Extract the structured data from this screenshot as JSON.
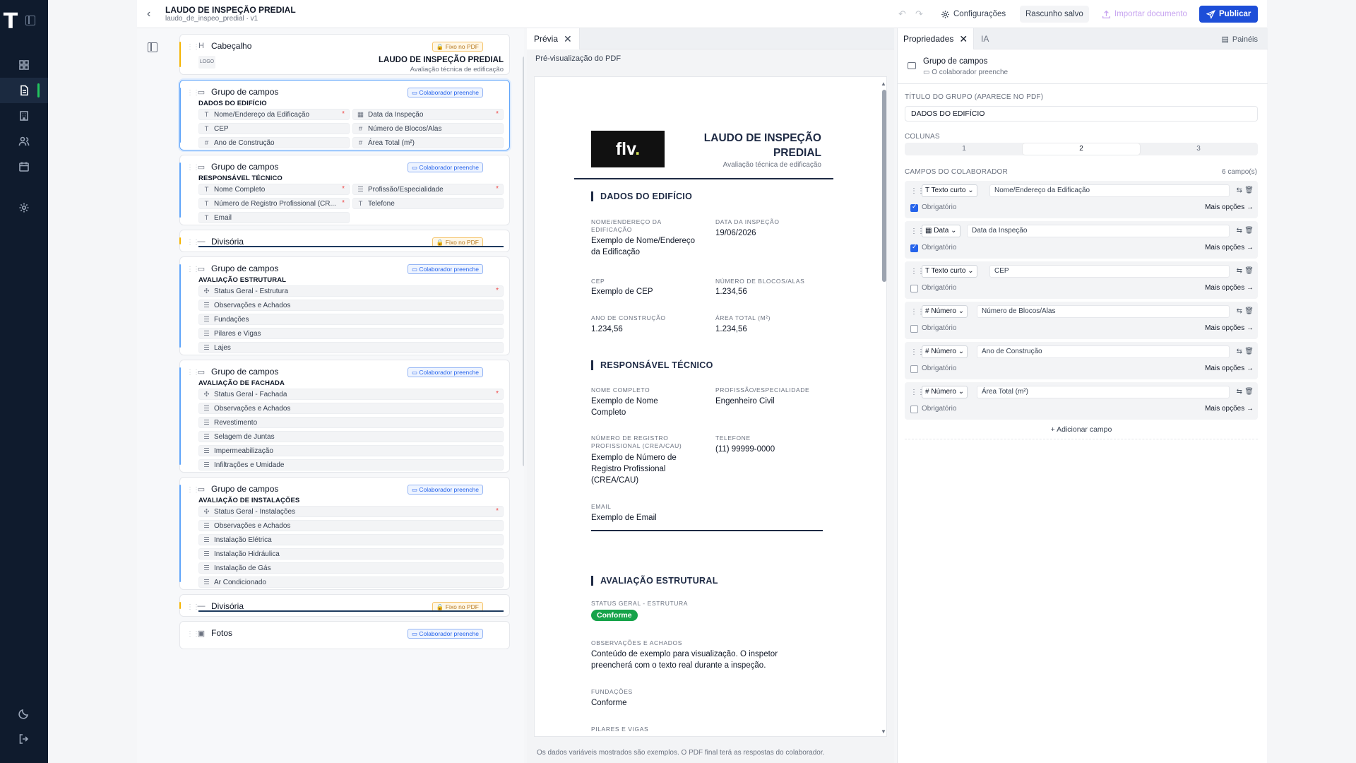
{
  "header": {
    "title": "LAUDO DE INSPEÇÃO PREDIAL",
    "subtitle": "laudo_de_inspeo_predial · v1",
    "undo_icon": "undo-icon",
    "redo_icon": "redo-icon",
    "config_label": "Configurações",
    "draft_label": "Rascunho salvo",
    "import_label": "Importar documento",
    "publish_label": "Publicar"
  },
  "outline": {
    "blocks": [
      {
        "type": "Cabeçalho",
        "badge": "Fixo no PDF",
        "logo": "LOGO",
        "title": "LAUDO DE INSPEÇÃO PREDIAL",
        "sub": "Avaliação técnica de edificação"
      },
      {
        "type": "Grupo de campos",
        "badge": "Colaborador preenche",
        "title": "DADOS DO EDIFÍCIO",
        "fields": [
          "Nome/Endereço da Edificação",
          "Data da Inspeção",
          "CEP",
          "Número de Blocos/Alas",
          "Ano de Construção",
          "Área Total (m²)"
        ]
      },
      {
        "type": "Grupo de campos",
        "badge": "Colaborador preenche",
        "title": "RESPONSÁVEL TÉCNICO",
        "fields": [
          "Nome Completo",
          "Profissão/Especialidade",
          "Número de Registro Profissional (CR...",
          "Telefone",
          "Email"
        ]
      },
      {
        "type": "Divisória",
        "badge": "Fixo no PDF"
      },
      {
        "type": "Grupo de campos",
        "badge": "Colaborador preenche",
        "title": "AVALIAÇÃO ESTRUTURAL",
        "fields": [
          "Status Geral - Estrutura",
          "Observações e Achados",
          "Fundações",
          "Pilares e Vigas",
          "Lajes"
        ]
      },
      {
        "type": "Grupo de campos",
        "badge": "Colaborador preenche",
        "title": "AVALIAÇÃO DE FACHADA",
        "fields": [
          "Status Geral - Fachada",
          "Observações e Achados",
          "Revestimento",
          "Selagem de Juntas",
          "Impermeabilização",
          "Infiltrações e Umidade"
        ]
      },
      {
        "type": "Grupo de campos",
        "badge": "Colaborador preenche",
        "title": "AVALIAÇÃO DE INSTALAÇÕES",
        "fields": [
          "Status Geral - Instalações",
          "Observações e Achados",
          "Instalação Elétrica",
          "Instalação Hidráulica",
          "Instalação de Gás",
          "Ar Condicionado"
        ]
      },
      {
        "type": "Divisória",
        "badge": "Fixo no PDF"
      },
      {
        "type": "Fotos",
        "badge": "Colaborador preenche"
      }
    ]
  },
  "preview": {
    "tab_label": "Prévia",
    "heading": "Pré-visualização do PDF",
    "footer": "Os dados variáveis mostrados são exemplos. O PDF final terá as respostas do colaborador.",
    "pdf": {
      "logo_text": "flv",
      "logo_dot": ".",
      "title": "LAUDO DE INSPEÇÃO PREDIAL",
      "subtitle": "Avaliação técnica de edificação",
      "sec1": "DADOS DO EDIFÍCIO",
      "f_nome_lbl": "NOME/ENDEREÇO DA EDIFICAÇÃO",
      "f_nome_val": "Exemplo de Nome/Endereço da Edificação",
      "f_data_lbl": "DATA DA INSPEÇÃO",
      "f_data_val": "19/06/2026",
      "f_cep_lbl": "CEP",
      "f_cep_val": "Exemplo de CEP",
      "f_blocos_lbl": "NÚMERO DE BLOCOS/ALAS",
      "f_blocos_val": "1.234,56",
      "f_ano_lbl": "ANO DE CONSTRUÇÃO",
      "f_ano_val": "1.234,56",
      "f_area_lbl": "ÁREA TOTAL (M²)",
      "f_area_val": "1.234,56",
      "sec2": "RESPONSÁVEL TÉCNICO",
      "f_nc_lbl": "NOME COMPLETO",
      "f_nc_val": "Exemplo de Nome Completo",
      "f_prof_lbl": "PROFISSÃO/ESPECIALIDADE",
      "f_prof_val": "Engenheiro Civil",
      "f_reg_lbl": "NÚMERO DE REGISTRO PROFISSIONAL (CREA/CAU)",
      "f_reg_val": "Exemplo de Número de Registro Profissional (CREA/CAU)",
      "f_tel_lbl": "TELEFONE",
      "f_tel_val": "(11) 99999-0000",
      "f_email_lbl": "EMAIL",
      "f_email_val": "Exemplo de Email",
      "sec3": "AVALIAÇÃO ESTRUTURAL",
      "f_status_lbl": "STATUS GERAL - ESTRUTURA",
      "f_status_val": "Conforme",
      "f_obs_lbl": "OBSERVAÇÕES E ACHADOS",
      "f_obs_val": "Conteúdo de exemplo para visualização. O inspetor preencherá com o texto real durante a inspeção.",
      "f_fund_lbl": "FUNDAÇÕES",
      "f_fund_val": "Conforme",
      "f_pil_lbl": "PILARES E VIGAS"
    }
  },
  "properties": {
    "tab_label": "Propriedades",
    "ia_label": "IA",
    "panels_label": "Painéis",
    "head_title": "Grupo de campos",
    "head_sub": "O colaborador preenche",
    "group_title_label": "TÍTULO DO GRUPO (APARECE NO PDF)",
    "group_title_value": "DADOS DO EDIFÍCIO",
    "columns_label": "COLUNAS",
    "columns": [
      "1",
      "2",
      "3"
    ],
    "columns_selected": "2",
    "fields_label": "CAMPOS DO COLABORADOR",
    "fields_count": "6 campo(s)",
    "required_label": "Obrigatório",
    "more_label": "Mais opções →",
    "fields": [
      {
        "type": "Texto curto",
        "name": "Nome/Endereço da Edificação",
        "required": true
      },
      {
        "type": "Data",
        "name": "Data da Inspeção",
        "required": true
      },
      {
        "type": "Texto curto",
        "name": "CEP",
        "required": false
      },
      {
        "type": "Número",
        "name": "Número de Blocos/Alas",
        "required": false
      },
      {
        "type": "Número",
        "name": "Ano de Construção",
        "required": false
      },
      {
        "type": "Número",
        "name": "Área Total (m²)",
        "required": false
      }
    ],
    "add_field_label": "+ Adicionar campo"
  },
  "colors": {
    "accent": "#1d4ed8",
    "rail": "#0f1b2d",
    "success": "#16a34a",
    "fixed_badge": "#b7791f",
    "colab_badge": "#2563eb"
  }
}
